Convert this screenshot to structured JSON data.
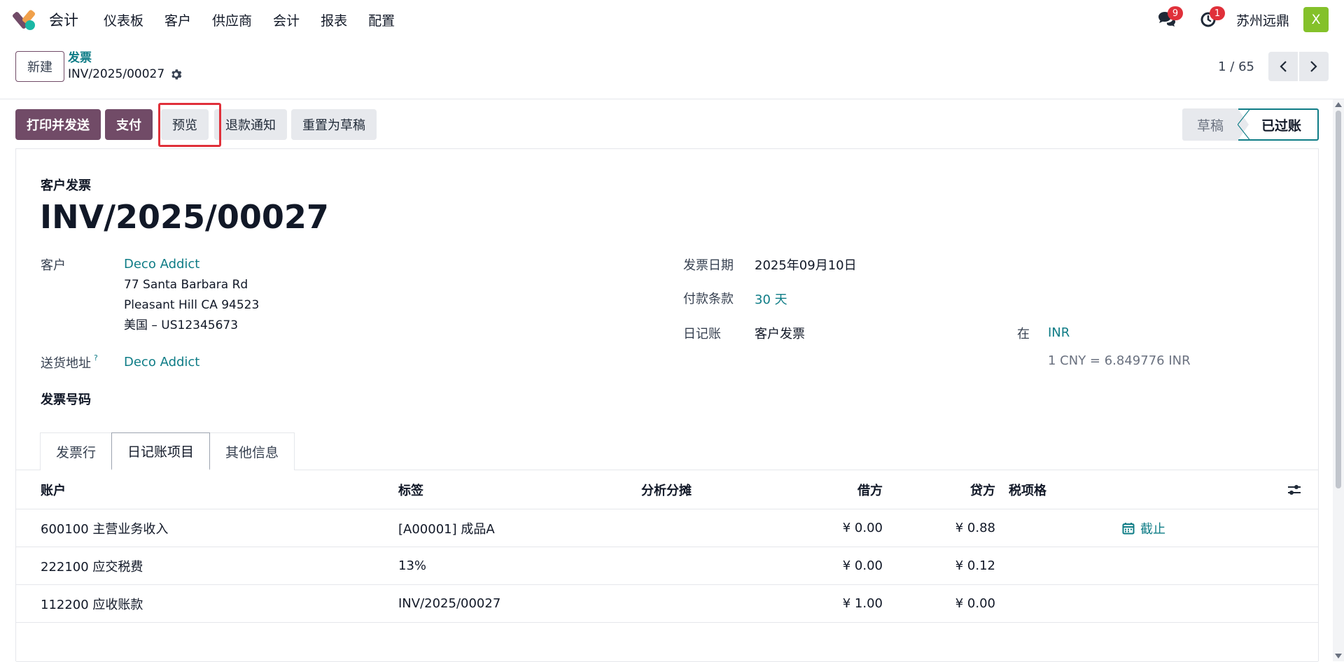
{
  "navbar": {
    "brand": "会计",
    "menu": [
      "仪表板",
      "客户",
      "供应商",
      "会计",
      "报表",
      "配置"
    ],
    "messages_count": "9",
    "activities_count": "1",
    "company": "苏州远鼎",
    "avatar_letter": "X"
  },
  "control": {
    "new_label": "新建",
    "breadcrumb_parent": "发票",
    "breadcrumb_current": "INV/2025/00027",
    "pager": "1 / 65"
  },
  "actions": {
    "print_send": "打印并发送",
    "pay": "支付",
    "preview": "预览",
    "credit_note": "退款通知",
    "reset_draft": "重置为草稿"
  },
  "status": {
    "draft": "草稿",
    "posted": "已过账"
  },
  "form": {
    "doc_type": "客户发票",
    "doc_name": "INV/2025/00027",
    "customer_label": "客户",
    "customer_name": "Deco Addict",
    "address_line1": "77 Santa Barbara Rd",
    "address_line2": "Pleasant Hill CA 94523",
    "address_line3": "美国 – US12345673",
    "delivery_label": "送货地址",
    "delivery_help": "?",
    "delivery_value": "Deco Addict",
    "invoice_number_label": "发票号码",
    "invoice_date_label": "发票日期",
    "invoice_date": "2025年09月10日",
    "payment_terms_label": "付款条款",
    "payment_terms": "30 天",
    "journal_label": "日记账",
    "journal": "客户发票",
    "currency_in": "在",
    "currency": "INR",
    "rate": "1 CNY = 6.849776 INR"
  },
  "tabs": [
    "发票行",
    "日记账项目",
    "其他信息"
  ],
  "table": {
    "headers": {
      "account": "账户",
      "label": "标签",
      "analytic": "分析分摊",
      "debit": "借方",
      "credit": "贷方",
      "tax_grid": "税项格"
    },
    "rows": [
      {
        "account": "600100 主营业务收入",
        "label": "[A00001] 成品A",
        "debit": "¥ 0.00",
        "credit": "¥ 0.88",
        "cutoff": "截止"
      },
      {
        "account": "222100 应交税费",
        "label": "13%",
        "debit": "¥ 0.00",
        "credit": "¥ 0.12",
        "cutoff": ""
      },
      {
        "account": "112200 应收账款",
        "label": "INV/2025/00027",
        "debit": "¥ 1.00",
        "credit": "¥ 0.00",
        "cutoff": ""
      }
    ]
  },
  "colors": {
    "primary": "#714b67",
    "link": "#0e7c86",
    "badge": "#e0303a",
    "avatar": "#84c12a"
  }
}
